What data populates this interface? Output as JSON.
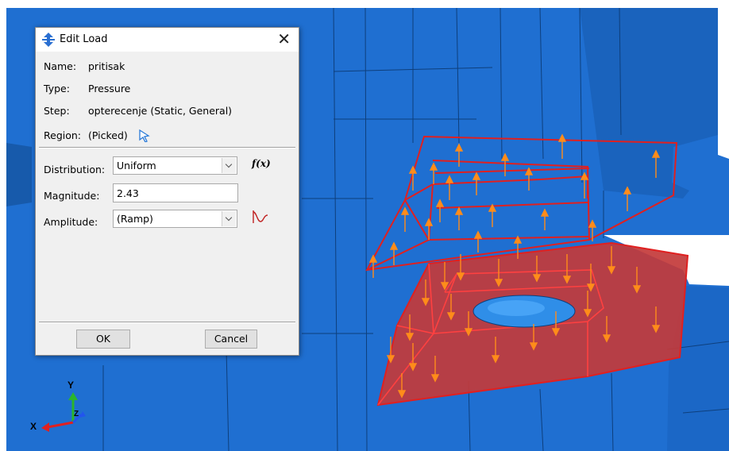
{
  "dialog": {
    "title": "Edit Load",
    "close_glyph": "✕",
    "name_label": "Name:",
    "name_value": "pritisak",
    "type_label": "Type:",
    "type_value": "Pressure",
    "step_label": "Step:",
    "step_value": "opterecenje (Static, General)",
    "region_label": "Region:",
    "region_value": "(Picked)",
    "distribution_label": "Distribution:",
    "distribution_value": "Uniform",
    "fx_label": "f(x)",
    "magnitude_label": "Magnitude:",
    "magnitude_value": "2.43",
    "amplitude_label": "Amplitude:",
    "amplitude_value": "(Ramp)",
    "ok_label": "OK",
    "cancel_label": "Cancel"
  },
  "triad": {
    "x_label": "X",
    "y_label": "Y",
    "z_label": "Z"
  },
  "colors": {
    "model": "#1f6fd1",
    "selection_edge": "#e02020",
    "selection_fill": "#c33a3a",
    "arrow": "#ff8c1a"
  },
  "icons": {
    "title_icon": "load-icon",
    "region_pick": "cursor-pick-icon",
    "amplitude": "amplitude-curve-icon"
  }
}
